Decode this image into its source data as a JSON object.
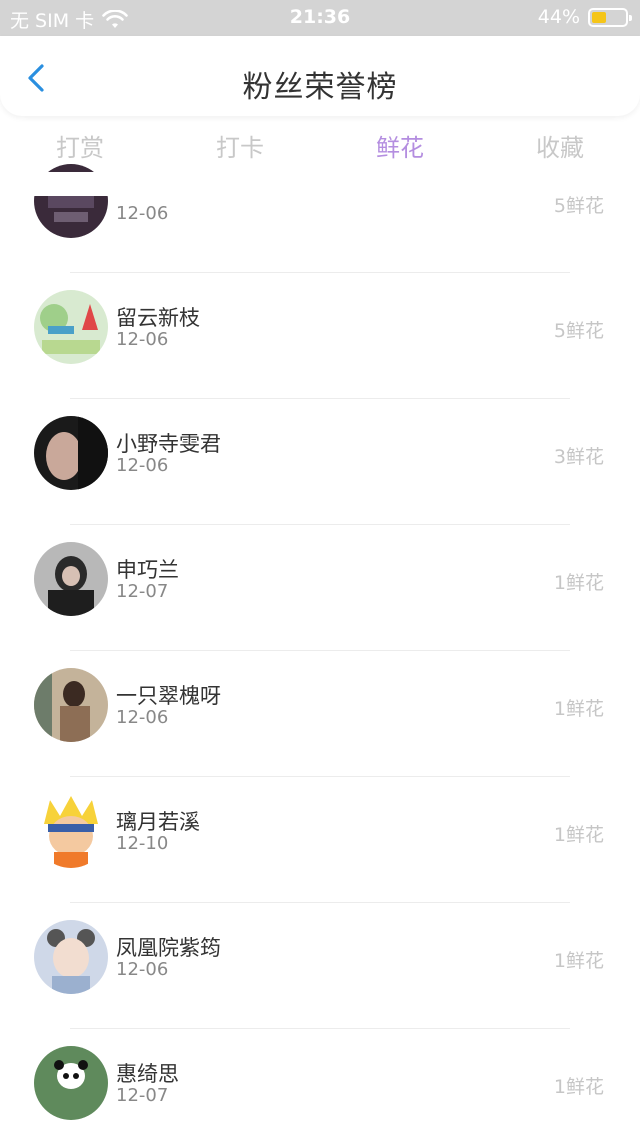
{
  "status_bar": {
    "carrier": "无 SIM 卡",
    "time": "21:36",
    "battery": "44%",
    "battery_level": 0.44,
    "wifi_icon": "wifi-icon"
  },
  "nav": {
    "title": "粉丝荣誉榜",
    "back_icon": "chevron-left-icon"
  },
  "tabs": [
    {
      "label": "打赏",
      "active": false
    },
    {
      "label": "打卡",
      "active": false
    },
    {
      "label": "鲜花",
      "active": true
    },
    {
      "label": "收藏",
      "active": false
    }
  ],
  "colors": {
    "accent": "#b48ee0",
    "status_bar": "#d4d4d4",
    "battery": "#f5c518"
  },
  "list": [
    {
      "name": "",
      "date": "12-06",
      "count": "5鲜花"
    },
    {
      "name": "留云新枝",
      "date": "12-06",
      "count": "5鲜花"
    },
    {
      "name": "小野寺雯君",
      "date": "12-06",
      "count": "3鲜花"
    },
    {
      "name": "申巧兰",
      "date": "12-07",
      "count": "1鲜花"
    },
    {
      "name": "一只翠槐呀",
      "date": "12-06",
      "count": "1鲜花"
    },
    {
      "name": "璃月若溪",
      "date": "12-10",
      "count": "1鲜花"
    },
    {
      "name": "凤凰院紫筠",
      "date": "12-06",
      "count": "1鲜花"
    },
    {
      "name": "惠绮思",
      "date": "12-07",
      "count": "1鲜花"
    }
  ]
}
